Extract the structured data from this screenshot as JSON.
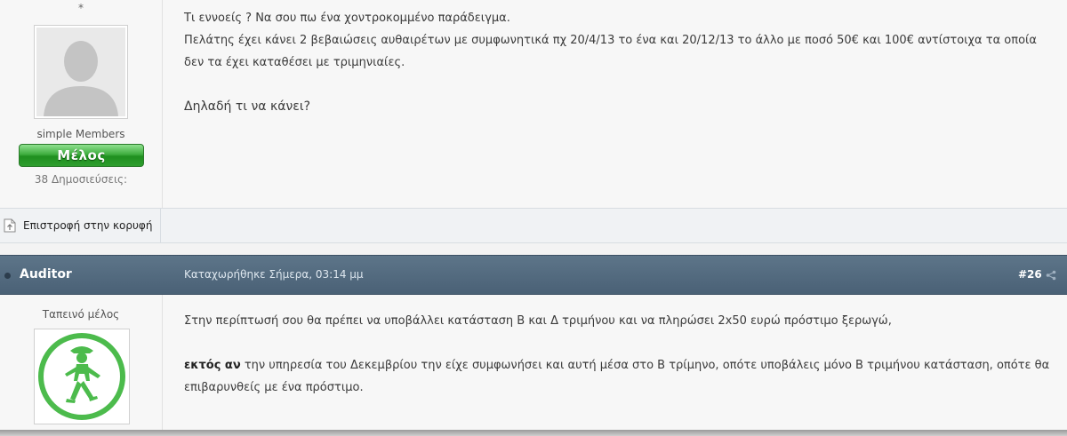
{
  "post1": {
    "star": "*",
    "user_title": "simple Members",
    "rank": "Μέλος",
    "post_count": "38 Δημοσιεύσεις:",
    "message": {
      "line1": "Τι εννοείς ? Να σου πω ένα χοντροκομμένο παράδειγμα.",
      "line2": "Πελάτης έχει κάνει 2 βεβαιώσεις αυθαιρέτων με συμφωνητικά πχ 20/4/13 το ένα και 20/12/13 το άλλο με ποσό 50€ και 100€ αντίστοιχα τα οποία",
      "line3": "δεν τα έχει καταθέσει με τριμηνιαίες.",
      "question": "Δηλαδή τι να κάνει?"
    }
  },
  "footer": {
    "back_to_top": "Επιστροφή στην κορυφή",
    "icon": "page-icon"
  },
  "post2": {
    "author": "Auditor",
    "date": "Καταχωρήθηκε Σήμερα, 03:14 μμ",
    "number": "#26",
    "user_title": "Ταπεινό μέλος",
    "message": {
      "line1": "Στην περίπτωσή σου θα πρέπει να υποβάλλει κατάσταση Β και Δ τριμήνου και να πληρώσει 2x50 ευρώ πρόστιμο ξερωγώ,",
      "bold": "εκτός αν",
      "line2_rest": " την υπηρεσία του Δεκεμβρίου την είχε συμφωνήσει και αυτή μέσα στο Β τρίμηνο, οπότε υποβάλεις μόνο Β τριμήνου κατάσταση, οπότε θα",
      "line3": "επιβαρυνθείς με ένα πρόστιμο."
    }
  },
  "colors": {
    "header_bg": "#4f667b",
    "rank_green": "#3fae3f",
    "avatar_green": "#4cbb4c"
  }
}
